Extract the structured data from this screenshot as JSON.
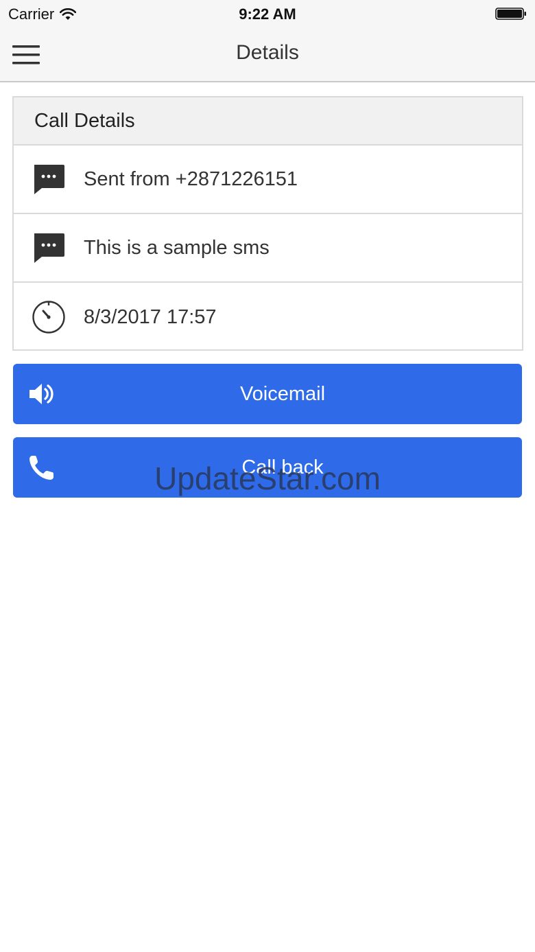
{
  "status_bar": {
    "carrier": "Carrier",
    "time": "9:22 AM",
    "wifi_icon": "wifi-icon",
    "battery_icon": "battery-icon"
  },
  "nav": {
    "title": "Details",
    "menu_icon": "hamburger-menu-icon"
  },
  "card": {
    "header": "Call Details",
    "rows": [
      {
        "icon": "message-icon",
        "text": "Sent from +2871226151"
      },
      {
        "icon": "message-icon",
        "text": "This is a sample sms"
      },
      {
        "icon": "timer-icon",
        "text": "8/3/2017 17:57"
      }
    ]
  },
  "buttons": {
    "voicemail": {
      "label": "Voicemail",
      "icon": "speaker-icon"
    },
    "callback": {
      "label": "Call back",
      "icon": "phone-icon"
    }
  },
  "watermark": "UpdateStar.com",
  "colors": {
    "accent": "#2f6be8",
    "bar_background": "#f6f6f6",
    "border": "#dadada"
  }
}
